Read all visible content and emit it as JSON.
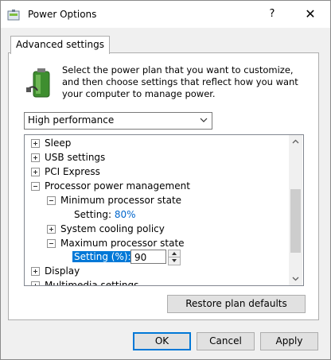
{
  "window": {
    "title": "Power Options"
  },
  "titlebar": {
    "help": "?",
    "close": "✕"
  },
  "tab": {
    "label": "Advanced settings"
  },
  "description": "Select the power plan that you want to customize, and then choose settings that reflect how you want your computer to manage power.",
  "plan": {
    "selected": "High performance"
  },
  "tree": {
    "sleep": "Sleep",
    "usb": "USB settings",
    "pci": "PCI Express",
    "ppm": "Processor power management",
    "min_state": "Minimum processor state",
    "min_setting_label": "Setting:",
    "min_setting_value": "80%",
    "cooling": "System cooling policy",
    "max_state": "Maximum processor state",
    "max_setting_label": "Setting (%):",
    "max_setting_value": "90",
    "display": "Display",
    "multimedia": "Multimedia settings"
  },
  "buttons": {
    "restore": "Restore plan defaults",
    "ok": "OK",
    "cancel": "Cancel",
    "apply": "Apply"
  },
  "colors": {
    "accent": "#0078d7",
    "value_blue": "#0066cc"
  }
}
